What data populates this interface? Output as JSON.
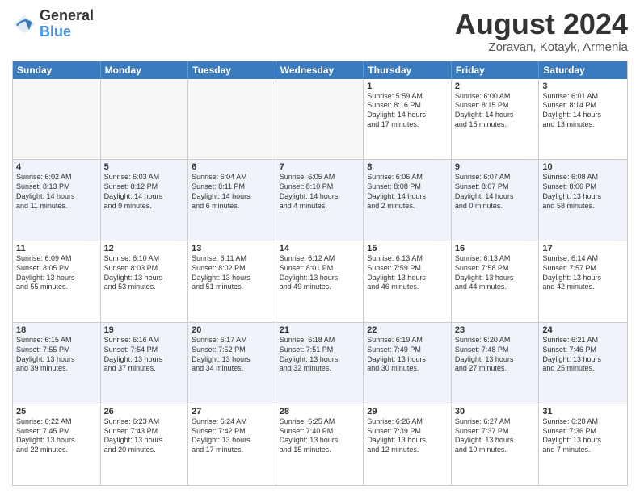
{
  "logo": {
    "general": "General",
    "blue": "Blue"
  },
  "title": "August 2024",
  "location": "Zoravan, Kotayk, Armenia",
  "header_days": [
    "Sunday",
    "Monday",
    "Tuesday",
    "Wednesday",
    "Thursday",
    "Friday",
    "Saturday"
  ],
  "rows": [
    [
      {
        "day": "",
        "info": ""
      },
      {
        "day": "",
        "info": ""
      },
      {
        "day": "",
        "info": ""
      },
      {
        "day": "",
        "info": ""
      },
      {
        "day": "1",
        "info": "Sunrise: 5:59 AM\nSunset: 8:16 PM\nDaylight: 14 hours\nand 17 minutes."
      },
      {
        "day": "2",
        "info": "Sunrise: 6:00 AM\nSunset: 8:15 PM\nDaylight: 14 hours\nand 15 minutes."
      },
      {
        "day": "3",
        "info": "Sunrise: 6:01 AM\nSunset: 8:14 PM\nDaylight: 14 hours\nand 13 minutes."
      }
    ],
    [
      {
        "day": "4",
        "info": "Sunrise: 6:02 AM\nSunset: 8:13 PM\nDaylight: 14 hours\nand 11 minutes."
      },
      {
        "day": "5",
        "info": "Sunrise: 6:03 AM\nSunset: 8:12 PM\nDaylight: 14 hours\nand 9 minutes."
      },
      {
        "day": "6",
        "info": "Sunrise: 6:04 AM\nSunset: 8:11 PM\nDaylight: 14 hours\nand 6 minutes."
      },
      {
        "day": "7",
        "info": "Sunrise: 6:05 AM\nSunset: 8:10 PM\nDaylight: 14 hours\nand 4 minutes."
      },
      {
        "day": "8",
        "info": "Sunrise: 6:06 AM\nSunset: 8:08 PM\nDaylight: 14 hours\nand 2 minutes."
      },
      {
        "day": "9",
        "info": "Sunrise: 6:07 AM\nSunset: 8:07 PM\nDaylight: 14 hours\nand 0 minutes."
      },
      {
        "day": "10",
        "info": "Sunrise: 6:08 AM\nSunset: 8:06 PM\nDaylight: 13 hours\nand 58 minutes."
      }
    ],
    [
      {
        "day": "11",
        "info": "Sunrise: 6:09 AM\nSunset: 8:05 PM\nDaylight: 13 hours\nand 55 minutes."
      },
      {
        "day": "12",
        "info": "Sunrise: 6:10 AM\nSunset: 8:03 PM\nDaylight: 13 hours\nand 53 minutes."
      },
      {
        "day": "13",
        "info": "Sunrise: 6:11 AM\nSunset: 8:02 PM\nDaylight: 13 hours\nand 51 minutes."
      },
      {
        "day": "14",
        "info": "Sunrise: 6:12 AM\nSunset: 8:01 PM\nDaylight: 13 hours\nand 49 minutes."
      },
      {
        "day": "15",
        "info": "Sunrise: 6:13 AM\nSunset: 7:59 PM\nDaylight: 13 hours\nand 46 minutes."
      },
      {
        "day": "16",
        "info": "Sunrise: 6:13 AM\nSunset: 7:58 PM\nDaylight: 13 hours\nand 44 minutes."
      },
      {
        "day": "17",
        "info": "Sunrise: 6:14 AM\nSunset: 7:57 PM\nDaylight: 13 hours\nand 42 minutes."
      }
    ],
    [
      {
        "day": "18",
        "info": "Sunrise: 6:15 AM\nSunset: 7:55 PM\nDaylight: 13 hours\nand 39 minutes."
      },
      {
        "day": "19",
        "info": "Sunrise: 6:16 AM\nSunset: 7:54 PM\nDaylight: 13 hours\nand 37 minutes."
      },
      {
        "day": "20",
        "info": "Sunrise: 6:17 AM\nSunset: 7:52 PM\nDaylight: 13 hours\nand 34 minutes."
      },
      {
        "day": "21",
        "info": "Sunrise: 6:18 AM\nSunset: 7:51 PM\nDaylight: 13 hours\nand 32 minutes."
      },
      {
        "day": "22",
        "info": "Sunrise: 6:19 AM\nSunset: 7:49 PM\nDaylight: 13 hours\nand 30 minutes."
      },
      {
        "day": "23",
        "info": "Sunrise: 6:20 AM\nSunset: 7:48 PM\nDaylight: 13 hours\nand 27 minutes."
      },
      {
        "day": "24",
        "info": "Sunrise: 6:21 AM\nSunset: 7:46 PM\nDaylight: 13 hours\nand 25 minutes."
      }
    ],
    [
      {
        "day": "25",
        "info": "Sunrise: 6:22 AM\nSunset: 7:45 PM\nDaylight: 13 hours\nand 22 minutes."
      },
      {
        "day": "26",
        "info": "Sunrise: 6:23 AM\nSunset: 7:43 PM\nDaylight: 13 hours\nand 20 minutes."
      },
      {
        "day": "27",
        "info": "Sunrise: 6:24 AM\nSunset: 7:42 PM\nDaylight: 13 hours\nand 17 minutes."
      },
      {
        "day": "28",
        "info": "Sunrise: 6:25 AM\nSunset: 7:40 PM\nDaylight: 13 hours\nand 15 minutes."
      },
      {
        "day": "29",
        "info": "Sunrise: 6:26 AM\nSunset: 7:39 PM\nDaylight: 13 hours\nand 12 minutes."
      },
      {
        "day": "30",
        "info": "Sunrise: 6:27 AM\nSunset: 7:37 PM\nDaylight: 13 hours\nand 10 minutes."
      },
      {
        "day": "31",
        "info": "Sunrise: 6:28 AM\nSunset: 7:36 PM\nDaylight: 13 hours\nand 7 minutes."
      }
    ]
  ]
}
